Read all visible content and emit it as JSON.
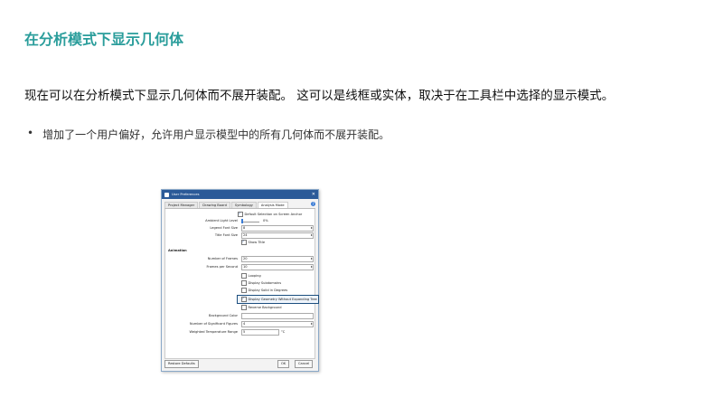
{
  "page": {
    "title": "在分析模式下显示几何体",
    "paragraph": "现在可以在分析模式下显示几何体而不展开装配。 这可以是线框或实体，取决于在工具栏中选择的显示模式。",
    "bullet_symbol": "•",
    "bullet_text": "增加了一个用户偏好，允许用户显示模型中的所有几何体而不展开装配。"
  },
  "dialog": {
    "title": "User Preferences",
    "tabs": [
      {
        "label": "Project Manager"
      },
      {
        "label": "Drawing Board"
      },
      {
        "label": "Symbology"
      },
      {
        "label": "Analysis Mode"
      }
    ],
    "active_tab": "Analysis Mode",
    "options": {
      "default_selection": "Default Selection on Screen Anchor",
      "ambient_light_label": "Ambient Light Level",
      "ambient_light_value": "0%",
      "legend_font_size_label": "Legend Font Size",
      "legend_font_size_value": "8",
      "title_font_size_label": "Title Font Size",
      "title_font_size_value": "24",
      "show_title": "Show Title"
    },
    "animation": {
      "section_label": "Animation",
      "number_of_frames_label": "Number of Frames",
      "number_of_frames_value": "20",
      "frames_per_second_label": "Frames per Second",
      "frames_per_second_value": "10",
      "looping": "Looping",
      "display_subdomains": "Display Subdomains",
      "display_solid_in_degrees": "Display Solid in Degrees",
      "display_geometry": "Display Geometry Without Expanding Tree",
      "reverse_background": "Reverse Background"
    },
    "other": {
      "background_color_label": "Background Color",
      "sig_figures_label": "Number of Significant Figures",
      "sig_figures_value": "4",
      "temp_range_label": "Weighted Temperature Range",
      "temp_range_value": "5",
      "temp_unit": "°C"
    },
    "footer": {
      "restore": "Restore Defaults",
      "ok": "OK",
      "cancel": "Cancel"
    }
  },
  "colors": {
    "title": "#2a9d9b",
    "titlebar": "#2b5a98",
    "highlight_border": "#1d4f7f"
  }
}
